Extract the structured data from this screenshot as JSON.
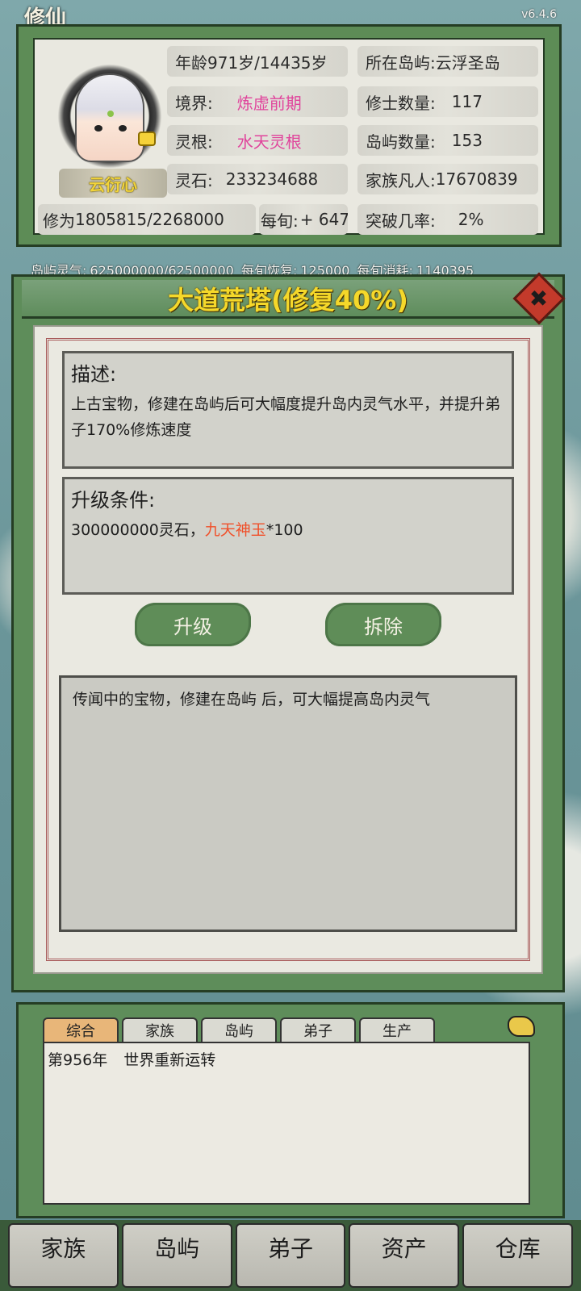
{
  "app": {
    "version": "v6.4.6",
    "corner_title": "修仙"
  },
  "character": {
    "name": "云衍心",
    "age_label": "年龄",
    "age_value": "971岁/14435岁",
    "realm_label": "境界:",
    "realm_value": "炼虚前期",
    "root_label": "灵根:",
    "root_value": "水天灵根",
    "stone_label": "灵石:",
    "stone_value": "233234688",
    "cultivation_label": "修为",
    "cultivation_value": "1805815/2268000",
    "per_turn_label": "每旬:",
    "per_turn_value": "+ 647"
  },
  "island": {
    "location_label": "所在岛屿:",
    "location_value": "云浮圣岛",
    "cultivators_label": "修士数量:",
    "cultivators_value": "117",
    "islands_label": "岛屿数量:",
    "islands_value": "153",
    "mortals_label": "家族凡人:",
    "mortals_value": "17670839",
    "breakthrough_label": "突破几率:",
    "breakthrough_value": "2%"
  },
  "ticker": {
    "qi_label": "岛屿灵气:",
    "qi_value": "625000000/62500000",
    "recover_label": "每旬恢复:",
    "recover_value": "125000",
    "consume_label": "每旬消耗:",
    "consume_value": "1140395"
  },
  "modal": {
    "title": "大道荒塔(修复40%)",
    "close_symbol": "✖",
    "description_title": "描述:",
    "description_text": "上古宝物，修建在岛屿后可大幅度提升岛内灵气水平，并提升弟子170%修炼速度",
    "upgrade_title": "升级条件:",
    "upgrade_cost": "300000000灵石，",
    "upgrade_item": "九天神玉",
    "upgrade_qty": "*100",
    "upgrade_button": "升级",
    "demolish_button": "拆除",
    "lore_text": "传闻中的宝物，修建在岛屿 后，可大幅提高岛内灵气"
  },
  "log": {
    "tabs": [
      "综合",
      "家族",
      "岛屿",
      "弟子",
      "生产"
    ],
    "entry_year": "第956年",
    "entry_text": "世界重新运转"
  },
  "nav": [
    "家族",
    "岛屿",
    "弟子",
    "资产",
    "仓库"
  ]
}
